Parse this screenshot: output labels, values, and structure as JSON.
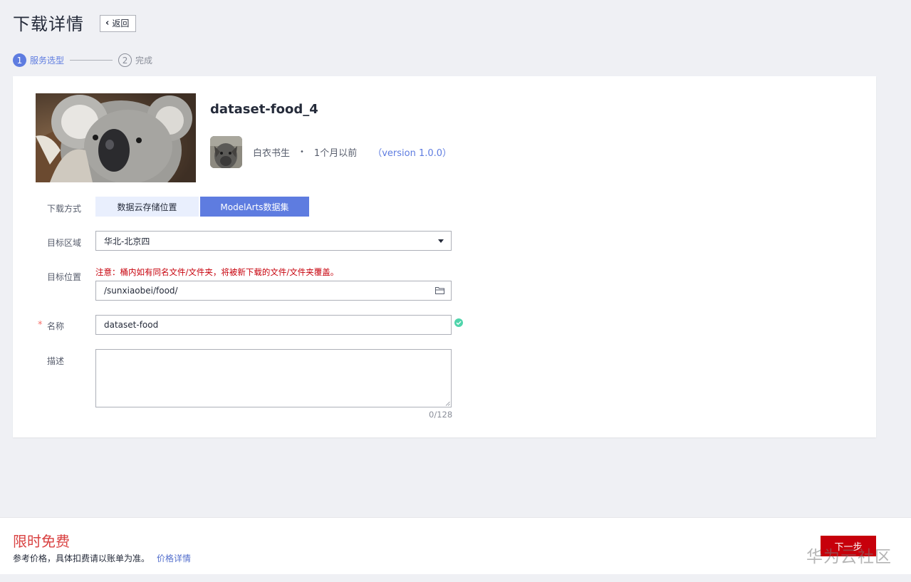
{
  "header": {
    "title": "下载详情",
    "back_label": "返回"
  },
  "steps": [
    {
      "number": "1",
      "label": "服务选型"
    },
    {
      "number": "2",
      "label": "完成"
    }
  ],
  "dataset": {
    "title": "dataset-food_4",
    "author": "白衣书生",
    "separator": "•",
    "time": "1个月以前",
    "version_open": "（",
    "version": "version 1.0.0",
    "version_close": "）"
  },
  "form": {
    "download_method_label": "下载方式",
    "method_options": [
      "数据云存储位置",
      "ModelArts数据集"
    ],
    "region_label": "目标区域",
    "region_value": "华北-北京四",
    "location_label": "目标位置",
    "location_warning": "注意：桶内如有同名文件/文件夹，将被新下载的文件/文件夹覆盖。",
    "location_value": "/sunxiaobei/food/",
    "required_mark": "*",
    "name_label": "名称",
    "name_value": "dataset-food",
    "desc_label": "描述",
    "desc_counter": "0/128"
  },
  "footer": {
    "free_title": "限时免费",
    "price_note": "参考价格，具体扣费请以账单为准。",
    "price_link": "价格详情",
    "next_label": "下一步"
  },
  "watermark": "华为云社区",
  "colors": {
    "brand_blue": "#5e7ce0",
    "danger_red": "#c7000b",
    "success_green": "#50d4ab"
  }
}
